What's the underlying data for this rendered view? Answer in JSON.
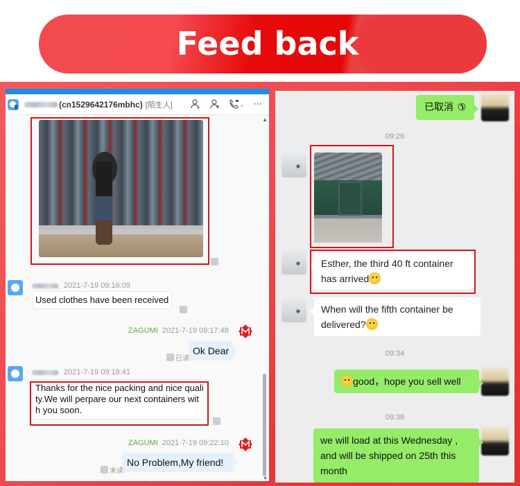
{
  "banner": {
    "title": "Feed back"
  },
  "left_chat": {
    "header": {
      "contact_id": "(cn1529642176mbhc)",
      "contact_tag": "[陌生人]",
      "actions": [
        "transfer-contact-icon",
        "add-contact-icon",
        "call-icon",
        "more-icon"
      ]
    },
    "messages": [
      {
        "type": "image",
        "side": "left",
        "description": "warehouse worker carrying clothing bale"
      },
      {
        "side": "left",
        "time": "2021-7-19 09:16:09",
        "text": "Used clothes have been received"
      },
      {
        "side": "right",
        "sender": "ZAGUMI",
        "time": "2021-7-19 09:17:48",
        "text": "Ok Dear",
        "status": "已读"
      },
      {
        "side": "left",
        "time": "2021-7-19 09:18:41",
        "text_lines": [
          "Thanks for the nice packing and nice quali",
          "ty.We will perpare our next containers wit",
          "h you soon."
        ]
      },
      {
        "side": "right",
        "sender": "ZAGUMI",
        "time": "2021-7-19 09:22:10",
        "text": "No Problem,My friend!",
        "status": "未读"
      }
    ]
  },
  "right_chat": {
    "messages": [
      {
        "side": "right",
        "text": "已取消",
        "icon": "phone-hangup-icon"
      },
      {
        "type": "timestamp",
        "text": "09:26"
      },
      {
        "type": "image",
        "side": "left",
        "description": "workers unloading shipping container"
      },
      {
        "side": "left",
        "text_lines": [
          "Esther, the third 40 ft container",
          "has arrived"
        ],
        "emoji": "smile"
      },
      {
        "side": "left",
        "text_lines": [
          "When will the fifth container be",
          "delivered?"
        ],
        "emoji": "thinking"
      },
      {
        "type": "timestamp",
        "text": "09:34"
      },
      {
        "side": "right",
        "text": "good，hope you sell well",
        "emoji": "smirk"
      },
      {
        "type": "timestamp",
        "text": "09:38"
      },
      {
        "side": "right",
        "text_lines": [
          "we will load at this Wednesday ,",
          "and will be shipped on 25th this",
          "month"
        ]
      }
    ]
  },
  "colors": {
    "banner_red": "#e60808",
    "highlight_box": "#d0161b",
    "wechat_green": "#95ec69",
    "sender_green": "#5aab45",
    "desktop_titlebar": "#1e8ceb"
  }
}
